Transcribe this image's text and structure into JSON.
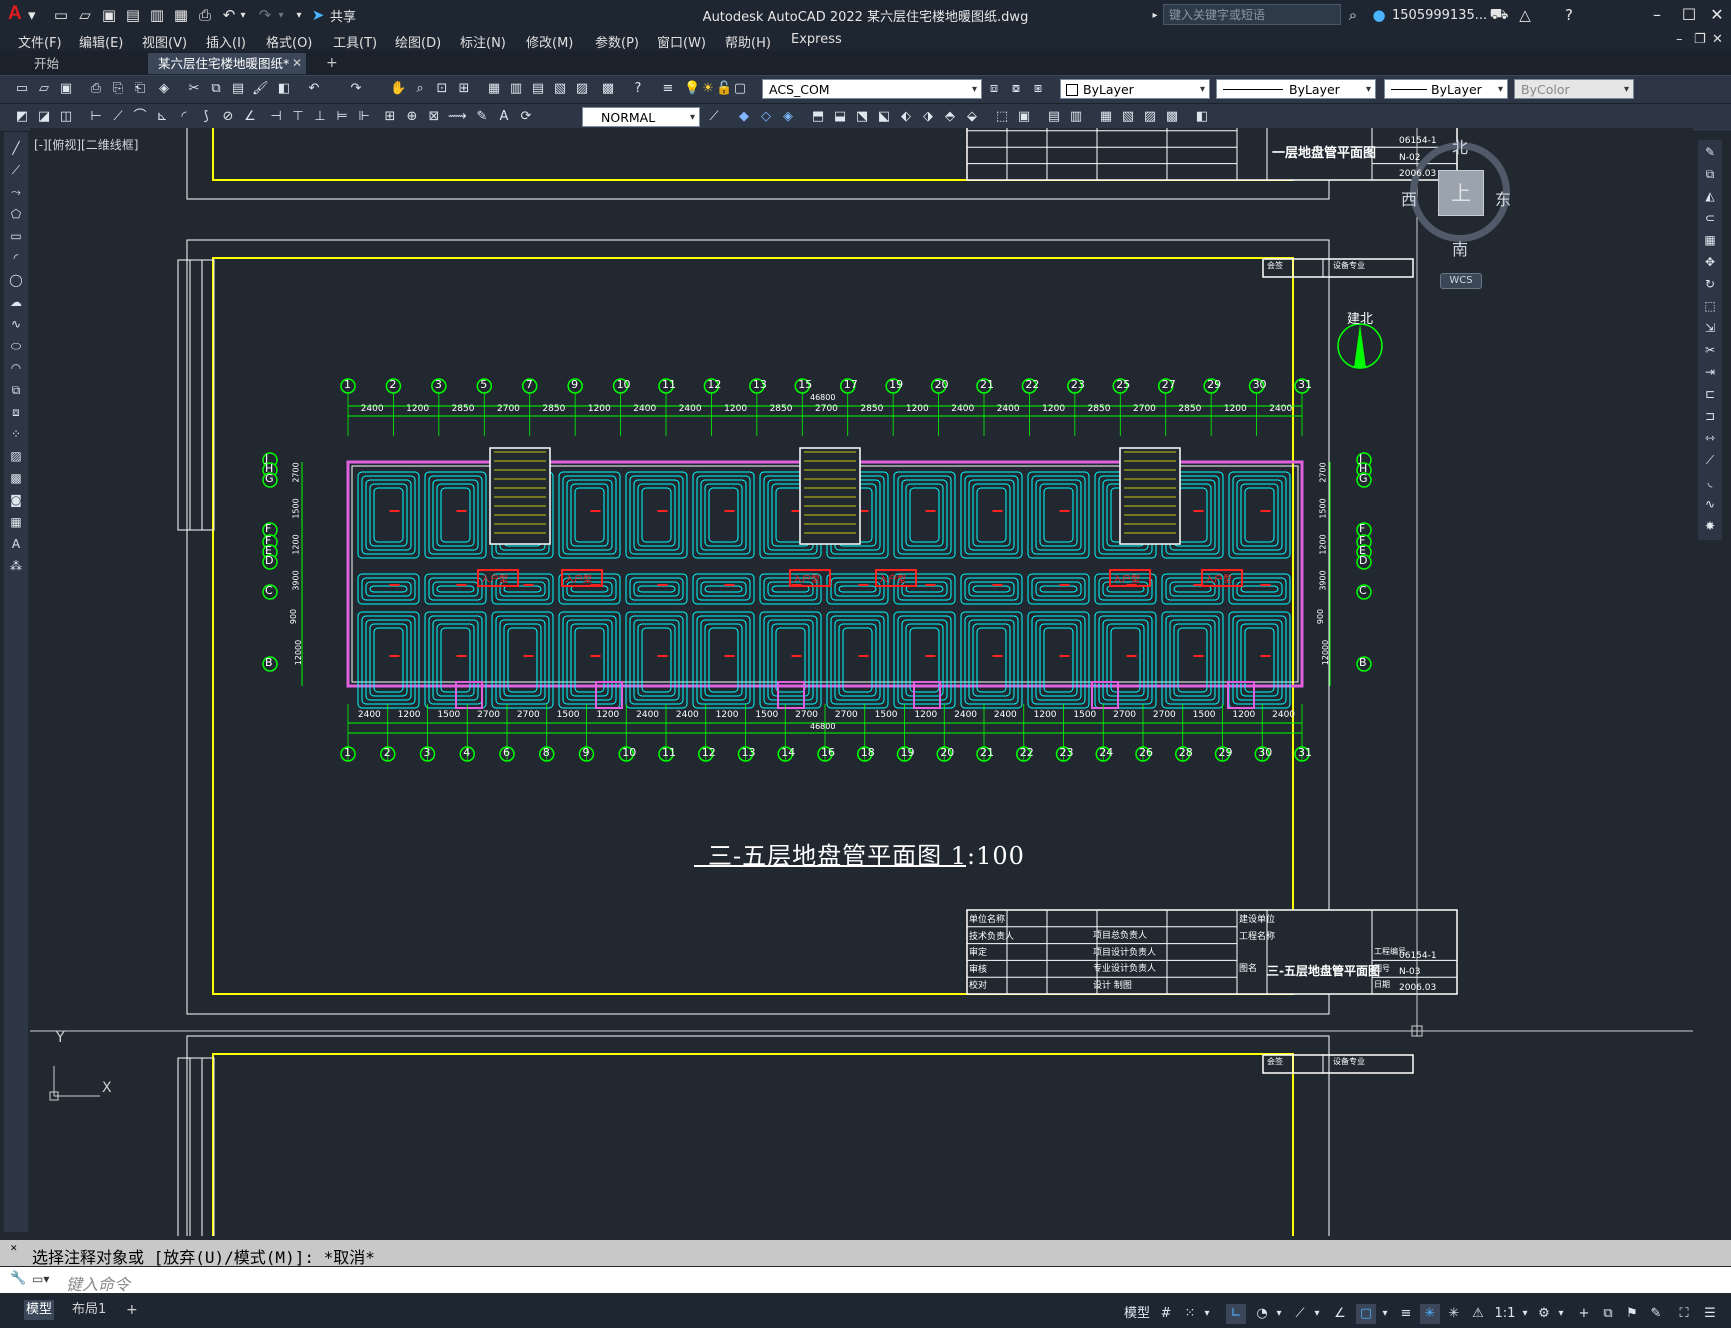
{
  "app": {
    "title": "Autodesk AutoCAD 2022    某六层住宅楼地暖图纸.dwg",
    "logo": "A",
    "share_label": "共享",
    "search_placeholder": "键入关键字或短语",
    "user": "1505999135...",
    "colors": {
      "accent": "#4cb3ff",
      "logo": "#e21b22",
      "frame": "#ffff00",
      "pipe": "#00ffff",
      "annotation": "#ff2020",
      "grid": "#00ff00"
    }
  },
  "menus": [
    "文件(F)",
    "编辑(E)",
    "视图(V)",
    "插入(I)",
    "格式(O)",
    "工具(T)",
    "绘图(D)",
    "标注(N)",
    "修改(M)",
    "参数(P)",
    "窗口(W)",
    "帮助(H)",
    "Express"
  ],
  "tabs": {
    "start": "开始",
    "active": "某六层住宅楼地暖图纸*",
    "add": "+"
  },
  "toolbar": {
    "layer": "ACS_COM",
    "color": "ByLayer",
    "linetype": "ByLayer",
    "lineweight": "ByLayer",
    "plotstyle": "ByColor",
    "dimstyle": "NORMAL"
  },
  "viewport": {
    "label": "[-][俯视][二维线框]",
    "compass": {
      "n": "北",
      "s": "南",
      "e": "东",
      "w": "西",
      "top": "上",
      "wcs": "WCS"
    },
    "ucs": {
      "x": "X",
      "y": "Y"
    }
  },
  "drawing": {
    "north_label": "建北",
    "main_title": "三-五层地盘管平面图",
    "scale": "1:100",
    "total_dim": "46800",
    "axis_top": [
      "1",
      "2",
      "3",
      "5",
      "7",
      "9",
      "10",
      "11",
      "12",
      "13",
      "15",
      "17",
      "19",
      "20",
      "21",
      "22",
      "23",
      "25",
      "27",
      "29",
      "30",
      "31"
    ],
    "axis_bottom": [
      "1",
      "2",
      "3",
      "4",
      "6",
      "8",
      "9",
      "10",
      "11",
      "12",
      "13",
      "14",
      "16",
      "18",
      "19",
      "20",
      "21",
      "22",
      "23",
      "24",
      "26",
      "28",
      "29",
      "30",
      "31"
    ],
    "dims_top": [
      "2400",
      "1200",
      "2850",
      "2700",
      "2850",
      "1200",
      "2400",
      "2400",
      "1200",
      "2850",
      "2700",
      "2850",
      "1200",
      "2400",
      "2400",
      "1200",
      "2850",
      "2700",
      "2850",
      "1200",
      "2400"
    ],
    "dims_bottom": [
      "2400",
      "1200",
      "1500",
      "2700",
      "2700",
      "1500",
      "1200",
      "2400",
      "2400",
      "1200",
      "1500",
      "2700",
      "2700",
      "1500",
      "1200",
      "2400",
      "2400",
      "1200",
      "1500",
      "2700",
      "2700",
      "1500",
      "1200",
      "2400"
    ],
    "axis_left": [
      "J",
      "H",
      "G",
      "F",
      "F",
      "E",
      "D",
      "C",
      "B"
    ],
    "dims_left": [
      "2700",
      "1500",
      "1200",
      "3900",
      "900",
      "12000"
    ],
    "rooms": [
      "入户型",
      "入户型",
      "入户型",
      "入户型",
      "入户型",
      "入户型"
    ],
    "title_blocks": [
      {
        "title": "一层地盘管平面图",
        "code": "06154-1",
        "sheet": "N-02",
        "date": "2006.03"
      },
      {
        "title": "三-五层地盘管平面图",
        "code": "06154-1",
        "sheet": "N-03",
        "date": "2006.03"
      }
    ],
    "tb_labels": [
      "单位名称",
      "技术负责人",
      "审定",
      "审核",
      "校对",
      "项目总负责人",
      "项目设计负责人",
      "专业设计负责人",
      "设计",
      "制图",
      "建设单位",
      "工程名称",
      "图名",
      "工程编号",
      "图号",
      "日期"
    ],
    "stamp": [
      "会签",
      "设备专业"
    ]
  },
  "command": {
    "history": "选择注释对象或 [放弃(U)/模式(M)]: *取消*",
    "placeholder": "键入命令"
  },
  "status": {
    "tabs": [
      "模型",
      "布局1",
      "+"
    ],
    "model": "模型",
    "scale": "1:1"
  }
}
